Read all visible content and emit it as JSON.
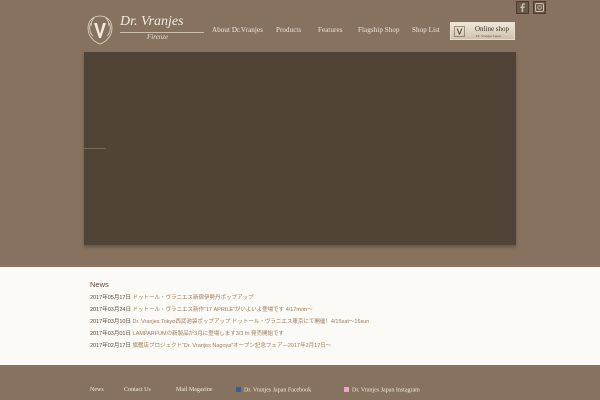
{
  "header": {
    "nav": [
      "About Dr.Vranjes",
      "Products",
      "Features",
      "Flagship Shop",
      "Shop List"
    ],
    "online_shop": {
      "label": "Online shop",
      "sub": "Dr. Vranjes Japan"
    }
  },
  "logo": {
    "name": "Dr. Vranjes",
    "city": "Firenze"
  },
  "news": {
    "title": "News",
    "items": [
      {
        "date": "2017年05月17日",
        "text": "ドットール・ヴラニエス新宿伊勢丹ポップアップ"
      },
      {
        "date": "2017年03月24日",
        "text": "ドットール・ヴラニエス新作“17 APRILE”がいよいよ登場です 4/17mon～"
      },
      {
        "date": "2017年03月10日",
        "text": "Dr. Vranjes Tokyo西武池袋ポップアップ ドットール・ヴラニエス東京にて開催！4/15sat～16sun"
      },
      {
        "date": "2017年03月01日",
        "text": "LAMPARFUMの新製品が3月に登場します3/3 fri 発売開始です"
      },
      {
        "date": "2017年02月17日",
        "text": "旗艦店プロジェクト“Dr. Vranjes Nagoya”オープン記念フェア—2017年2月17日〜"
      }
    ]
  },
  "footer": {
    "links": [
      "News",
      "Contact Us",
      "Mail Magazine",
      "Dr. Vranjes Japan Facebook",
      "Dr. Vranjes Japan Instagram"
    ]
  },
  "colors": {
    "background": "#86725f",
    "hero": "#524337",
    "news_bg": "#fcfaf6",
    "news_link": "#9a7c5c",
    "nav_text": "#f1e8dc"
  },
  "icons": {
    "facebook": "facebook-icon",
    "instagram": "instagram-icon",
    "logo_mark": "v-crest-icon"
  }
}
